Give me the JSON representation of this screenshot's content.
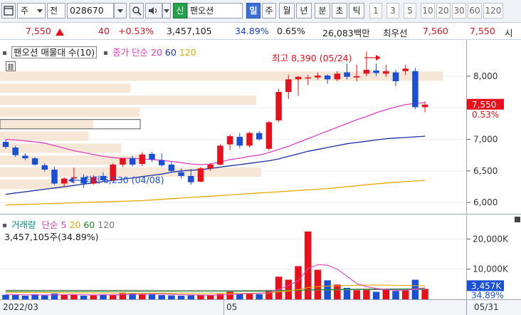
{
  "toolbar": {
    "type_label": "주",
    "prefix_label": "전",
    "code_value": "028670",
    "name_badge": "신",
    "name_value": "팬오션",
    "periods": [
      "일",
      "주",
      "월",
      "년",
      "분",
      "초",
      "틱"
    ],
    "minutes": [
      "1",
      "3",
      "5",
      "10",
      "20",
      "30",
      "60",
      "120"
    ]
  },
  "quote": {
    "price": "7,550",
    "change": "40",
    "change_pct": "+0.53%",
    "volume": "3,457,105",
    "vol_ratio": "34.89%",
    "turnover_pct": "0.65%",
    "amount": "26,083백만",
    "bid_label": "최우선",
    "bid": "7,560",
    "ask": "7,550",
    "time_label": "시"
  },
  "price_panel": {
    "legend_title": "팬오션 매물대 수(10)",
    "legend_ma": "종가 단순",
    "legend_ma_periods": [
      "20",
      "60",
      "120"
    ],
    "max_annotation": "최고 8,390 (05/24)",
    "min_annotation": "최저 6,230 (04/08)",
    "current_label": "7,550",
    "current_pct": "0.53%",
    "yticks": [
      "8,000",
      "7,500",
      "7,000",
      "6,500",
      "6,000"
    ]
  },
  "volume_panel": {
    "legend_title": "거래량",
    "legend_ma": "단순",
    "legend_ma_periods": [
      "5",
      "20",
      "60",
      "120"
    ],
    "value_line": "3,457,105주(34.89%)",
    "yticks": [
      "20,000K",
      "10,000K"
    ],
    "current_label": "3,457K",
    "current_pct": "34.89%"
  },
  "xaxis": {
    "labels": [
      "2022/03",
      "05",
      "05/31"
    ]
  },
  "colors": {
    "up": "#e8101a",
    "down": "#1a4fd8",
    "ma20": "#e040c0",
    "ma60": "#1a2fa0",
    "ma120": "#e6a800",
    "profile": "#f5e6d6"
  },
  "chart_data": {
    "type": "candlestick",
    "ylim": [
      5900,
      8450
    ],
    "candles": [
      {
        "o": 6960,
        "h": 7000,
        "l": 6850,
        "c": 6880
      },
      {
        "o": 6870,
        "h": 6900,
        "l": 6720,
        "c": 6750
      },
      {
        "o": 6740,
        "h": 6780,
        "l": 6670,
        "c": 6700
      },
      {
        "o": 6700,
        "h": 6720,
        "l": 6580,
        "c": 6600
      },
      {
        "o": 6590,
        "h": 6620,
        "l": 6490,
        "c": 6520
      },
      {
        "o": 6520,
        "h": 6560,
        "l": 6280,
        "c": 6300
      },
      {
        "o": 6300,
        "h": 6400,
        "l": 6250,
        "c": 6380
      },
      {
        "o": 6380,
        "h": 6550,
        "l": 6300,
        "c": 6400
      },
      {
        "o": 6400,
        "h": 6450,
        "l": 6230,
        "c": 6300
      },
      {
        "o": 6300,
        "h": 6430,
        "l": 6280,
        "c": 6400
      },
      {
        "o": 6420,
        "h": 6480,
        "l": 6330,
        "c": 6350
      },
      {
        "o": 6350,
        "h": 6620,
        "l": 6340,
        "c": 6600
      },
      {
        "o": 6600,
        "h": 6700,
        "l": 6560,
        "c": 6700
      },
      {
        "o": 6700,
        "h": 6740,
        "l": 6570,
        "c": 6600
      },
      {
        "o": 6610,
        "h": 6800,
        "l": 6580,
        "c": 6760
      },
      {
        "o": 6770,
        "h": 6800,
        "l": 6640,
        "c": 6680
      },
      {
        "o": 6670,
        "h": 6780,
        "l": 6560,
        "c": 6590
      },
      {
        "o": 6600,
        "h": 6650,
        "l": 6470,
        "c": 6500
      },
      {
        "o": 6480,
        "h": 6540,
        "l": 6380,
        "c": 6420
      },
      {
        "o": 6420,
        "h": 6530,
        "l": 6280,
        "c": 6320
      },
      {
        "o": 6330,
        "h": 6560,
        "l": 6320,
        "c": 6540
      },
      {
        "o": 6540,
        "h": 6620,
        "l": 6500,
        "c": 6600
      },
      {
        "o": 6600,
        "h": 6920,
        "l": 6590,
        "c": 6900
      },
      {
        "o": 6920,
        "h": 7080,
        "l": 6830,
        "c": 7050
      },
      {
        "o": 7040,
        "h": 7100,
        "l": 6860,
        "c": 6900
      },
      {
        "o": 6900,
        "h": 7120,
        "l": 6870,
        "c": 7100
      },
      {
        "o": 7100,
        "h": 7130,
        "l": 6980,
        "c": 7000
      },
      {
        "o": 6850,
        "h": 7290,
        "l": 6820,
        "c": 7270
      },
      {
        "o": 7300,
        "h": 7800,
        "l": 7270,
        "c": 7750
      },
      {
        "o": 7750,
        "h": 8020,
        "l": 7640,
        "c": 7950
      },
      {
        "o": 7950,
        "h": 8000,
        "l": 7690,
        "c": 7990
      },
      {
        "o": 7970,
        "h": 8020,
        "l": 7860,
        "c": 7980
      },
      {
        "o": 7980,
        "h": 8060,
        "l": 7940,
        "c": 8010
      },
      {
        "o": 8010,
        "h": 8030,
        "l": 7880,
        "c": 7950
      },
      {
        "o": 7950,
        "h": 8080,
        "l": 7920,
        "c": 8040
      },
      {
        "o": 8060,
        "h": 8200,
        "l": 7950,
        "c": 7990
      },
      {
        "o": 7980,
        "h": 8180,
        "l": 7920,
        "c": 8000
      },
      {
        "o": 8040,
        "h": 8390,
        "l": 8000,
        "c": 8100
      },
      {
        "o": 8090,
        "h": 8200,
        "l": 8000,
        "c": 8050
      },
      {
        "o": 8040,
        "h": 8180,
        "l": 7990,
        "c": 8080
      },
      {
        "o": 8060,
        "h": 8100,
        "l": 7840,
        "c": 7920
      },
      {
        "o": 8080,
        "h": 8180,
        "l": 8020,
        "c": 8120
      },
      {
        "o": 8080,
        "h": 8130,
        "l": 7480,
        "c": 7510
      },
      {
        "o": 7510,
        "h": 7600,
        "l": 7430,
        "c": 7550
      }
    ],
    "ma20": [
      7000,
      6990,
      6975,
      6960,
      6940,
      6900,
      6860,
      6820,
      6790,
      6760,
      6730,
      6710,
      6700,
      6700,
      6690,
      6680,
      6670,
      6650,
      6630,
      6610,
      6600,
      6610,
      6640,
      6680,
      6700,
      6730,
      6750,
      6790,
      6840,
      6890,
      6950,
      7010,
      7070,
      7130,
      7190,
      7250,
      7310,
      7360,
      7420,
      7470,
      7510,
      7550,
      7570,
      7580
    ],
    "ma60": [
      6130,
      6150,
      6170,
      6190,
      6210,
      6230,
      6250,
      6270,
      6290,
      6310,
      6330,
      6350,
      6370,
      6390,
      6410,
      6430,
      6450,
      6480,
      6500,
      6510,
      6520,
      6540,
      6560,
      6580,
      6600,
      6620,
      6640,
      6660,
      6690,
      6730,
      6770,
      6810,
      6840,
      6870,
      6900,
      6930,
      6950,
      6970,
      6990,
      7010,
      7020,
      7030,
      7040,
      7050
    ],
    "ma120": [
      5960,
      5965,
      5970,
      5975,
      5980,
      5985,
      5990,
      5995,
      6000,
      6005,
      6010,
      6015,
      6020,
      6025,
      6030,
      6040,
      6050,
      6060,
      6070,
      6080,
      6090,
      6100,
      6110,
      6120,
      6130,
      6140,
      6150,
      6160,
      6170,
      6180,
      6190,
      6200,
      6210,
      6220,
      6235,
      6250,
      6265,
      6280,
      6295,
      6310,
      6320,
      6330,
      6340,
      6350
    ],
    "volume": [
      1500,
      1400,
      1200,
      1700,
      1300,
      1900,
      1500,
      1700,
      1200,
      1300,
      1600,
      1400,
      2200,
      1900,
      1800,
      1600,
      1400,
      1300,
      1200,
      1300,
      1500,
      1300,
      1800,
      2600,
      1900,
      1800,
      1700,
      3100,
      7500,
      6500,
      11000,
      22500,
      9800,
      6300,
      4900,
      3800,
      3000,
      3200,
      2500,
      3500,
      2800,
      3000,
      6500,
      3457
    ],
    "volume_ma5": [
      1600,
      1550,
      1500,
      1480,
      1460,
      1500,
      1520,
      1540,
      1480,
      1460,
      1480,
      1500,
      1560,
      1640,
      1700,
      1740,
      1720,
      1620,
      1540,
      1460,
      1400,
      1380,
      1420,
      1600,
      1780,
      1900,
      1960,
      2200,
      3300,
      4600,
      6200,
      10200,
      11500,
      11300,
      10000,
      7700,
      5200,
      4200,
      3600,
      3300,
      3000,
      3000,
      3500,
      3800
    ],
    "volume_ma20": [
      2300,
      2280,
      2260,
      2240,
      2220,
      2200,
      2180,
      2160,
      2140,
      2120,
      2100,
      2080,
      2060,
      2040,
      2020,
      2000,
      1980,
      1960,
      1940,
      1920,
      1900,
      1880,
      1870,
      1900,
      1950,
      2000,
      2050,
      2150,
      2500,
      2800,
      3200,
      3900,
      4200,
      4400,
      4500,
      4600,
      4650,
      4700,
      4700,
      4700,
      4650,
      4600,
      4550,
      4500
    ],
    "volume_ma60": [
      2700,
      2700,
      2690,
      2690,
      2680,
      2680,
      2670,
      2670,
      2660,
      2660,
      2650,
      2650,
      2640,
      2640,
      2630,
      2630,
      2620,
      2620,
      2610,
      2610,
      2600,
      2600,
      2600,
      2620,
      2640,
      2660,
      2680,
      2720,
      2800,
      2880,
      2960,
      3100,
      3180,
      3240,
      3290,
      3330,
      3360,
      3390,
      3410,
      3430,
      3450,
      3460,
      3470,
      3480
    ],
    "volume_ma120": [
      3000,
      3000,
      3000,
      3000,
      2990,
      2990,
      2990,
      2990,
      2980,
      2980,
      2980,
      2980,
      2970,
      2970,
      2970,
      2970,
      2960,
      2960,
      2960,
      2960,
      2950,
      2950,
      2950,
      2950,
      2950,
      2960,
      2970,
      2980,
      3000,
      3020,
      3040,
      3080,
      3100,
      3120,
      3140,
      3150,
      3160,
      3170,
      3180,
      3190,
      3200,
      3200,
      3210,
      3210
    ],
    "volume_ylim": [
      0,
      26000
    ],
    "profile_bars": [
      {
        "price": 8000,
        "width": 0.95
      },
      {
        "price": 7810,
        "width": 0.28
      },
      {
        "price": 7620,
        "width": 0.55
      },
      {
        "price": 7430,
        "width": 0.3
      },
      {
        "price": 7240,
        "width": 0.2
      },
      {
        "price": 7050,
        "width": 0.19
      },
      {
        "price": 6860,
        "width": 0.26
      },
      {
        "price": 6670,
        "width": 0.3
      },
      {
        "price": 6480,
        "width": 0.56
      },
      {
        "price": 6290,
        "width": 0.15
      }
    ]
  }
}
